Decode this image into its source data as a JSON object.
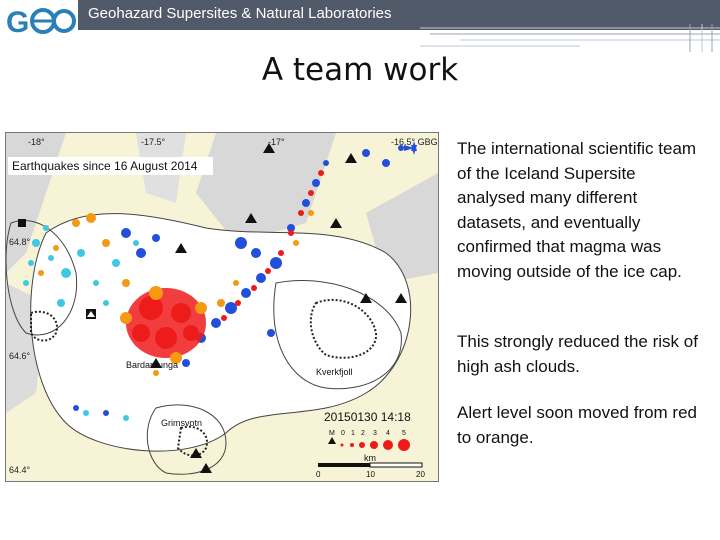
{
  "header": {
    "title": "Geohazard Supersites & Natural Laboratories",
    "logo_text": "GEO"
  },
  "slide": {
    "title": "A team work"
  },
  "map": {
    "legend_title": "Earthquakes since 16 August 2014",
    "lon_labels": [
      "-18°",
      "-17.5°",
      "-17°",
      "-16.5° GBG"
    ],
    "lat_labels": [
      "64.8°",
      "64.6°",
      "64.4°"
    ],
    "place_labels": [
      "Bardarbunga",
      "Kverkfjoll",
      "Grimsvotn"
    ],
    "timestamp": "20150130 14:18",
    "magnitude_label": "M",
    "magnitude_values": [
      "0",
      "1",
      "2",
      "3",
      "4",
      "5"
    ],
    "scale_unit": "km",
    "scale_values": [
      "0",
      "10",
      "20"
    ],
    "colors": {
      "ice": "#ffffff",
      "land": "#f7f3d6",
      "river_band": "#d6d6d6",
      "quake_red": "#ee1b1b",
      "quake_orange": "#f49a12",
      "quake_blue": "#2250dd",
      "quake_cyan": "#3fc7e6"
    }
  },
  "content": {
    "paragraph_1": "The international scientific team of the Iceland Supersite analysed many different datasets, and eventually confirmed that magma was moving outside of the ice cap.",
    "paragraph_2": "This strongly reduced the risk of high ash clouds.",
    "paragraph_3": "Alert level soon moved from red to orange."
  }
}
